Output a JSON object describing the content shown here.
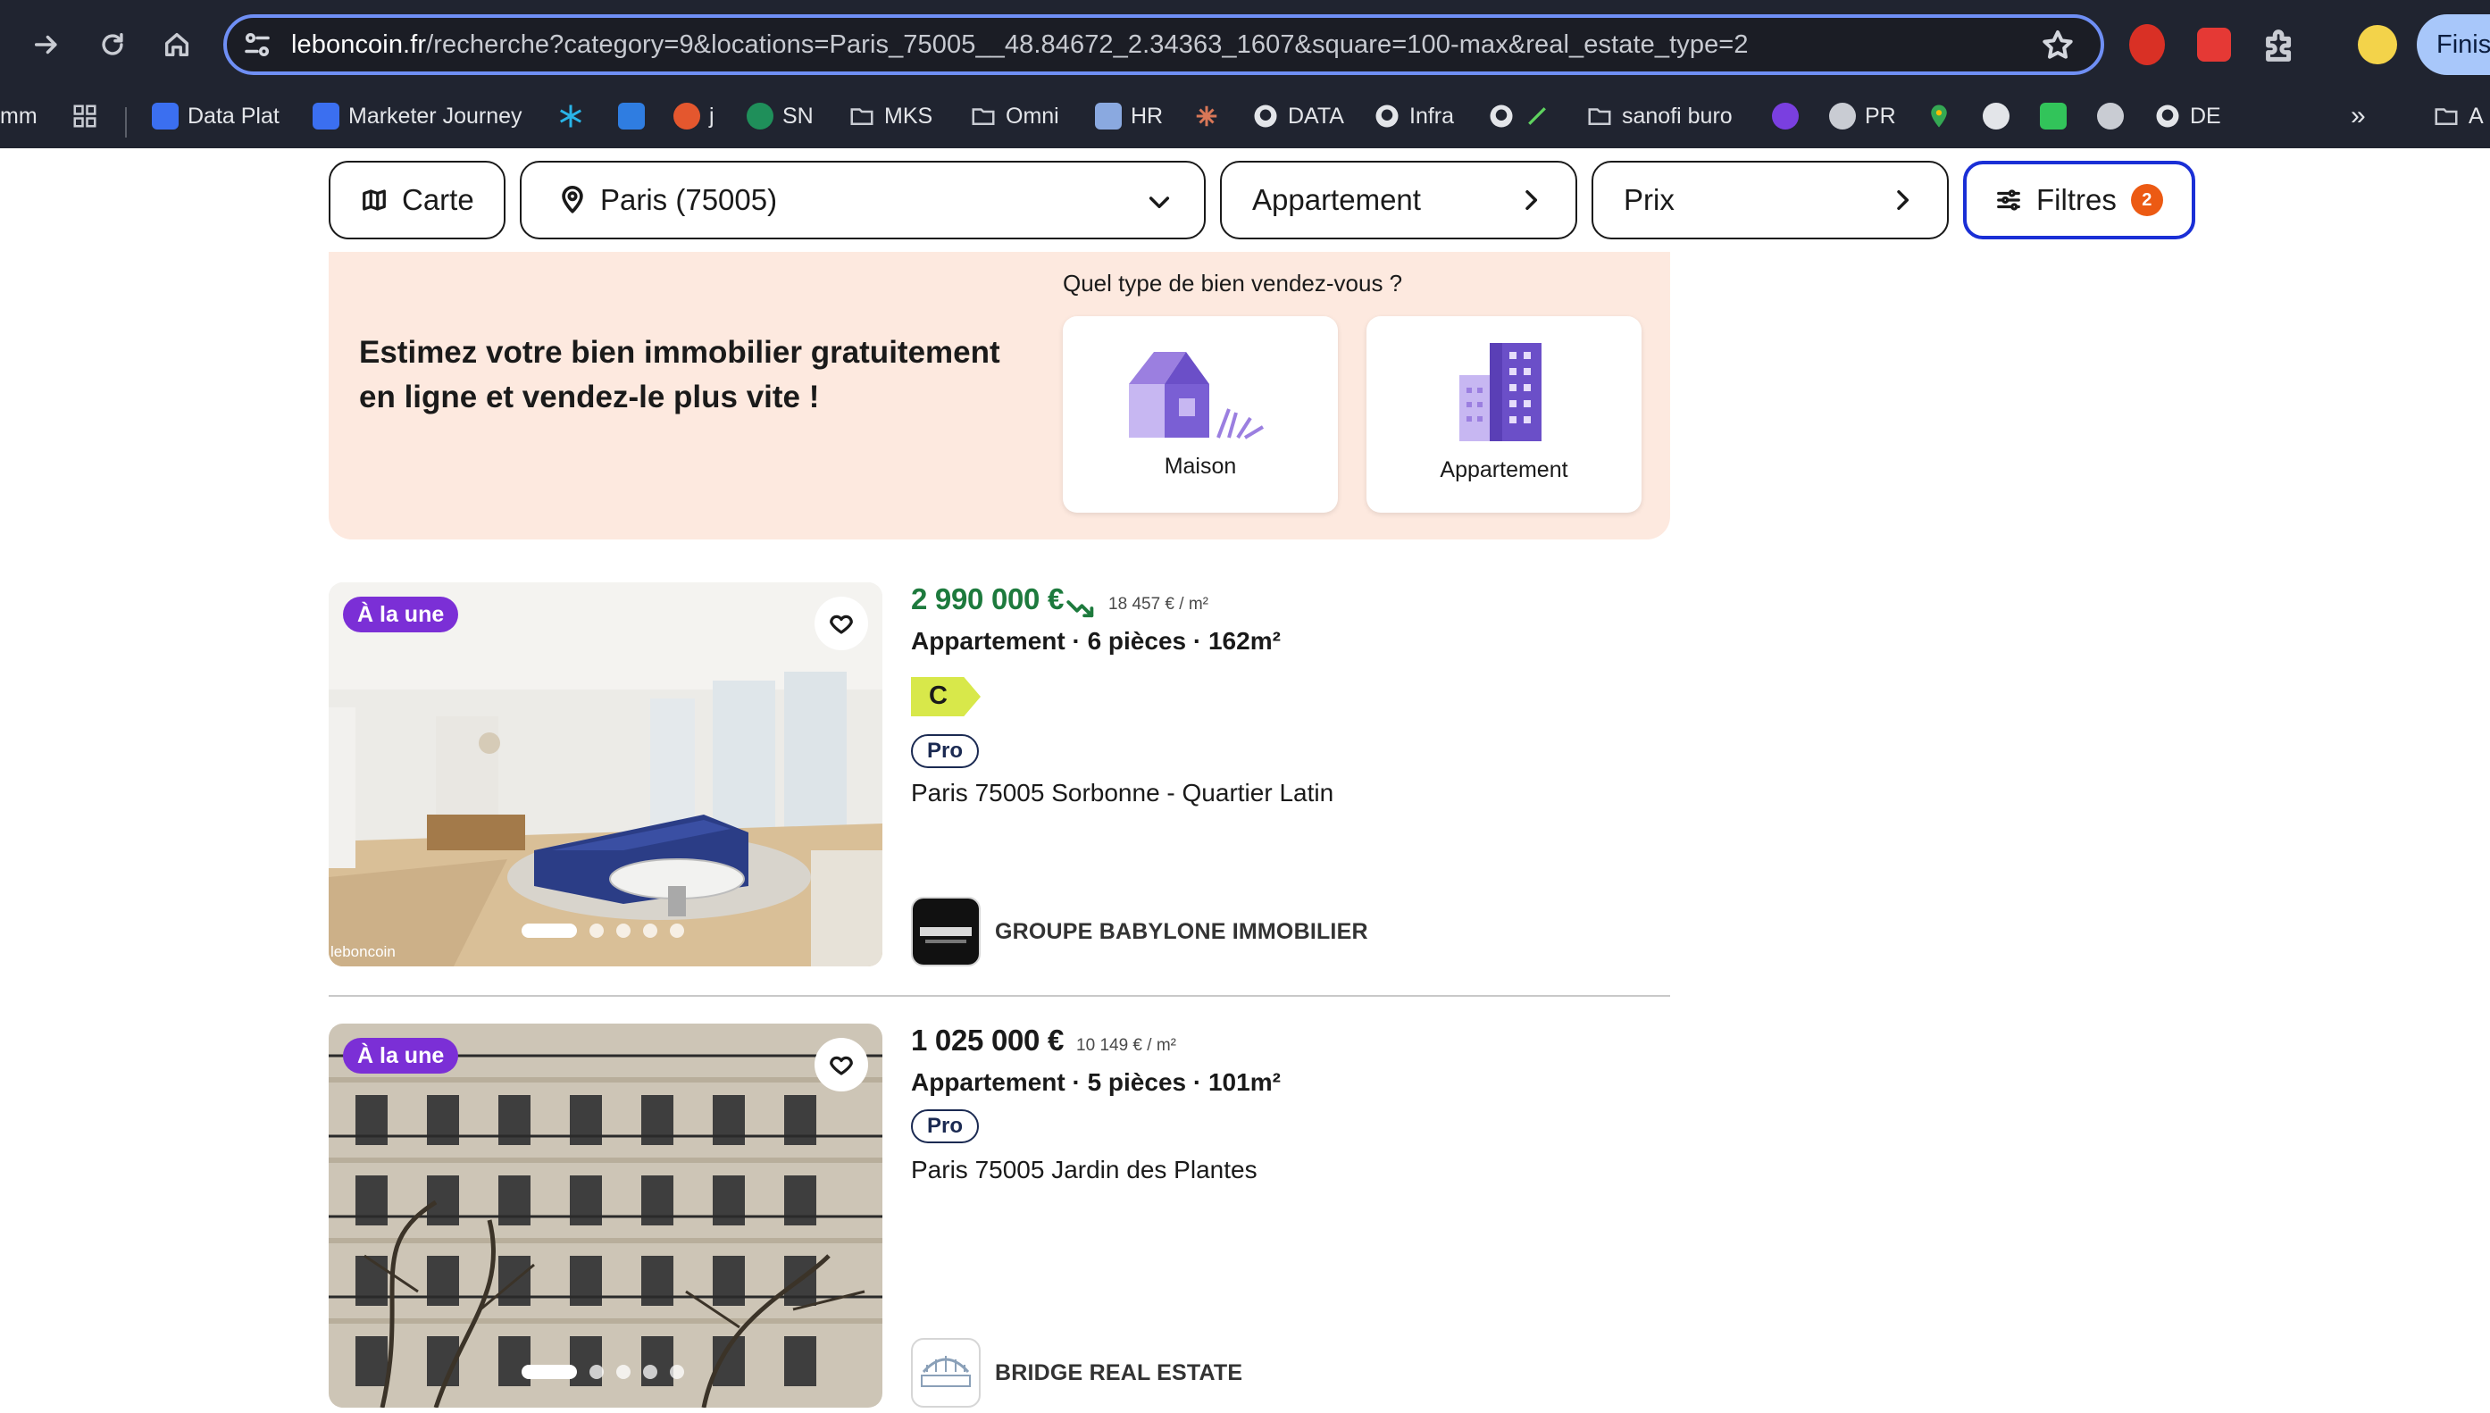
{
  "browser": {
    "url_host": "leboncoin.fr",
    "url_path": "/recherche?category=9&locations=Paris_75005__48.84672_2.34363_1607&square=100-max&real_estate_type=2",
    "finish_label": "Finish",
    "bookmarks": {
      "cut_label": "mm",
      "data_plat": "Data Plat",
      "marketer_journey": "Marketer Journey",
      "j": "j",
      "sn": "SN",
      "mks": "MKS",
      "omni": "Omni",
      "hr": "HR",
      "data": "DATA",
      "infra": "Infra",
      "sanofi_buro": "sanofi buro",
      "pr": "PR",
      "de": "DE",
      "more": "»",
      "cut_folder": "A"
    }
  },
  "filters": {
    "map_label": "Carte",
    "location_value": "Paris (75005)",
    "type_label": "Appartement",
    "price_label": "Prix",
    "filters_label": "Filtres",
    "filters_count": "2",
    "active_color": "#1a2fd6",
    "count_color": "#ec5a13"
  },
  "estimate": {
    "headline_line1": "Estimez votre bien immobilier gratuitement",
    "headline_line2": "en ligne et vendez-le plus vite !",
    "question": "Quel type de bien vendez-vous ?",
    "options": [
      {
        "label": "Maison",
        "icon": "house-icon"
      },
      {
        "label": "Appartement",
        "icon": "building-icon"
      }
    ],
    "background_color": "#fde9df"
  },
  "listings": [
    {
      "badge": "À la une",
      "price": "2 990 000 €",
      "price_trend": "price-down-icon",
      "price_per_m2": "18 457 € / m²",
      "title": "Appartement · 6 pièces · 162m²",
      "dpe": "C",
      "pro_label": "Pro",
      "location": "Paris 75005 Sorbonne - Quartier Latin",
      "seller": "GROUPE BABYLONE IMMOBILIER",
      "photo_watermark": "leboncoin",
      "photo_count": 5,
      "photo_index": 1
    },
    {
      "badge": "À la une",
      "price": "1 025 000 €",
      "price_per_m2": "10 149 € / m²",
      "title": "Appartement · 5 pièces · 101m²",
      "pro_label": "Pro",
      "location": "Paris 75005 Jardin des Plantes",
      "seller": "BRIDGE REAL ESTATE",
      "photo_count": 5,
      "photo_index": 1
    }
  ],
  "colors": {
    "badge_purple": "#7b2fd6",
    "price_green": "#1d7a3d",
    "dpe_c": "#d8e84a"
  }
}
